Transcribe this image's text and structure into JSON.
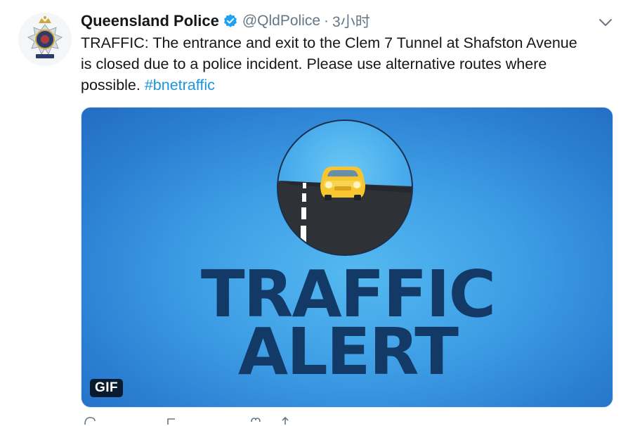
{
  "author": {
    "name": "Queensland Police",
    "handle": "@QldPolice",
    "separator": "·",
    "time": "3小时",
    "verified": true
  },
  "tweet": {
    "text": "TRAFFIC: The entrance and exit to the Clem 7 Tunnel at Shafston Avenue is closed due to a police incident. Please use alternative routes where possible. ",
    "hashtag": "#bnetraffic"
  },
  "media": {
    "line1": "TRAFFIC",
    "line2": "ALERT",
    "badge": "GIF",
    "colors": {
      "background": "#3f9fe6",
      "title": "#133a66",
      "car": "#f7c52e"
    }
  },
  "icons": {
    "avatar": "police-badge-icon",
    "verified": "verified-badge-icon",
    "menu": "chevron-down-icon",
    "actions": [
      "reply-icon",
      "retweet-icon",
      "like-icon",
      "share-icon"
    ]
  },
  "colors": {
    "link": "#1b95e0",
    "secondary": "#657786",
    "text": "#14171a"
  }
}
